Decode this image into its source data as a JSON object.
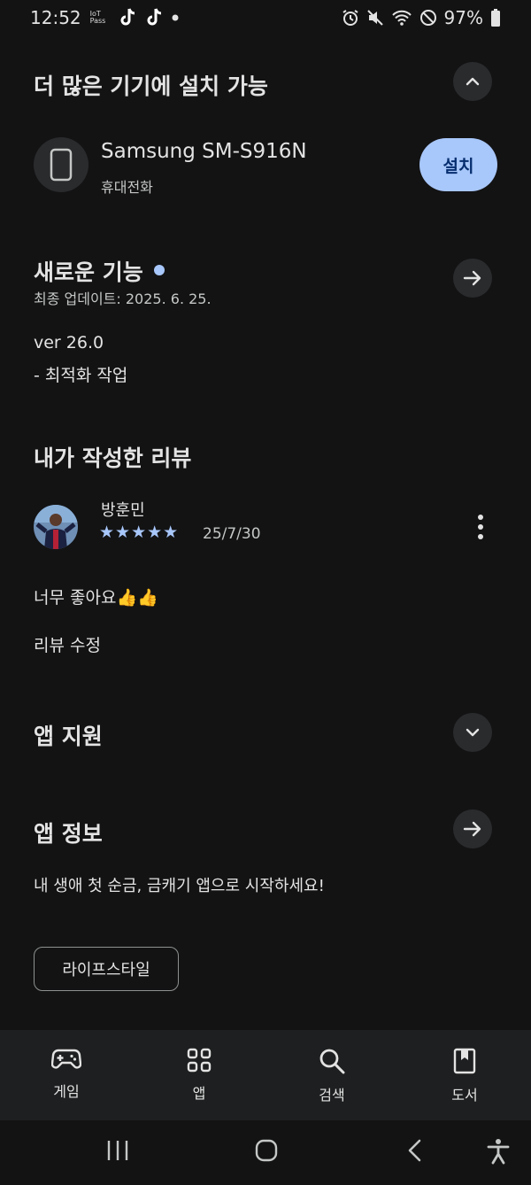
{
  "status_bar": {
    "time": "12:52",
    "iot_label": "IoT Pass",
    "battery": "97%",
    "icons": [
      "iot-pass-icon",
      "tiktok-icon",
      "tiktok-icon",
      "dot-icon",
      "alarm-icon",
      "mute-icon",
      "wifi-icon",
      "dnd-icon",
      "battery-icon"
    ]
  },
  "more_devices": {
    "title": "더 많은 기기에 설치 가능",
    "device_name": "Samsung SM-S916N",
    "device_type": "휴대전화",
    "install_label": "설치"
  },
  "whats_new": {
    "title": "새로운 기능",
    "last_updated": "최종 업데이트: 2025. 6. 25.",
    "version": "ver 26.0",
    "note": "- 최적화 작업"
  },
  "my_review": {
    "title": "내가 작성한 리뷰",
    "reviewer": "방훈민",
    "stars": "★★★★★",
    "rating": 5,
    "date": "25/7/30",
    "text": "너무 좋아요👍👍",
    "edit_label": "리뷰 수정"
  },
  "app_support": {
    "title": "앱 지원"
  },
  "app_info": {
    "title": "앱 정보",
    "description": "내 생애 첫 순금, 금캐기 앱으로 시작하세요!",
    "category": "라이프스타일"
  },
  "bottom_nav": {
    "items": [
      {
        "label": "게임",
        "icon": "gamepad-icon"
      },
      {
        "label": "앱",
        "icon": "apps-grid-icon"
      },
      {
        "label": "검색",
        "icon": "search-icon"
      },
      {
        "label": "도서",
        "icon": "book-icon"
      }
    ]
  },
  "colors": {
    "background": "#131314",
    "accent": "#a8c7fa",
    "surface": "#2a2b2d"
  }
}
